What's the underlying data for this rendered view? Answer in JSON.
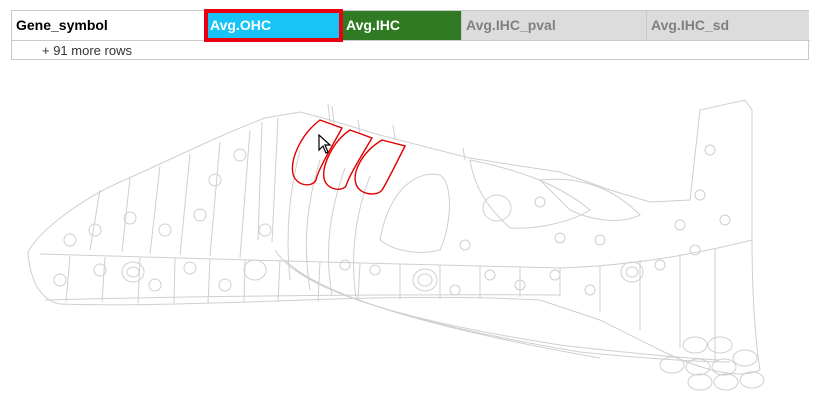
{
  "table": {
    "columns": [
      {
        "label": "Gene_symbol"
      },
      {
        "label": "Avg.OHC"
      },
      {
        "label": "Avg.IHC"
      },
      {
        "label": "Avg.IHC_pval"
      },
      {
        "label": "Avg.IHC_sd"
      }
    ],
    "more_rows_label": "+ 91 more rows"
  },
  "colors": {
    "avg_ohc_header": "#17c3f7",
    "avg_ihc_header": "#2f7a22",
    "selection_outline": "#e8000e",
    "highlighted_cells": "#e00000"
  },
  "icons": [
    "mouse-pointer-icon"
  ]
}
